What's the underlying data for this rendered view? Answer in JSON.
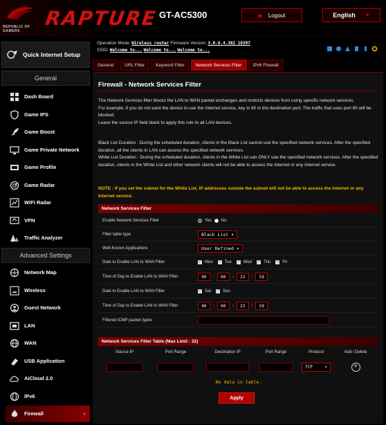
{
  "header": {
    "brand": "RAPTURE",
    "model": "GT-AC5300",
    "rog_line1": "REPUBLIC OF",
    "rog_line2": "GAMERS",
    "logout_label": "Logout",
    "language": "English"
  },
  "sidebar": {
    "quick_setup": "Quick Internet Setup",
    "general_title": "General",
    "general_items": [
      {
        "label": "Dash Board",
        "icon": "dashboard-icon"
      },
      {
        "label": "Game IPS",
        "icon": "shield-icon"
      },
      {
        "label": "Game Boost",
        "icon": "rocket-icon"
      },
      {
        "label": "Game Private Network",
        "icon": "private-network-icon"
      },
      {
        "label": "Game Profile",
        "icon": "profile-icon"
      },
      {
        "label": "Game Radar",
        "icon": "radar-icon"
      },
      {
        "label": "WiFi Radar",
        "icon": "wifi-radar-icon"
      },
      {
        "label": "VPN",
        "icon": "vpn-icon"
      },
      {
        "label": "Traffic Analyzer",
        "icon": "traffic-icon"
      }
    ],
    "advanced_title": "Advanced Settings",
    "advanced_items": [
      {
        "label": "Network Map",
        "icon": "network-map-icon"
      },
      {
        "label": "Wireless",
        "icon": "wireless-icon"
      },
      {
        "label": "Guest Network",
        "icon": "guest-icon"
      },
      {
        "label": "LAN",
        "icon": "lan-icon"
      },
      {
        "label": "WAN",
        "icon": "globe-icon"
      },
      {
        "label": "USB Application",
        "icon": "usb-icon"
      },
      {
        "label": "AiCloud 2.0",
        "icon": "cloud-icon"
      },
      {
        "label": "IPv6",
        "icon": "ipv6-icon"
      },
      {
        "label": "Firewall",
        "icon": "firewall-icon"
      }
    ]
  },
  "status": {
    "op_mode_label": "Operation Mode:",
    "op_mode_value": "Wireless router",
    "firmware_label": "Firmware Version:",
    "firmware_value": "3.0.0.4.382_10397",
    "ssid_label": "SSID:",
    "ssid_1": "Welcome to...",
    "ssid_2": "Welcome to...",
    "ssid_3": "Welcome to..."
  },
  "tabs": [
    "General",
    "URL Filter",
    "Keyword Filter",
    "Network Services Filter",
    "IPv6 Firewall"
  ],
  "active_tab_index": 3,
  "page": {
    "title": "Firewall - Network Services Filter",
    "desc1": "The Network Services filter blocks the LAN to WAN packet exchanges and restricts devices from using specific network services.",
    "desc2": "For example, if you do not want the device to use the Internet service, key in 80 in the destination port. The traffic that uses port 80 will be blocked.",
    "desc3": "Leave the source IP field blank to apply this rule to all LAN devices.",
    "desc4": "Black List Duration : During the scheduled duration, clients in the Black List cannot use the specified network services. After the specified duration, all the clients in LAN can access the specified network services.",
    "desc5": "White List Duration : During the scheduled duration, clients in the White List can ONLY use the specified network services. After the specified duration, clients in the White List and other network clients will not be able to access the Internet or any Internet service.",
    "note": "NOTE : If you set the subnet for the White List, IP addresses outside the subnet will not be able to access the Internet or any Internet service."
  },
  "form": {
    "section_title": "Network Services Filter",
    "enable_label": "Enable Network Services Filter",
    "yes": "Yes",
    "no": "No",
    "filter_type_label": "Filter table type",
    "filter_type_value": "Black List",
    "wk_apps_label": "Well-Known Applications",
    "wk_apps_value": "User Defined",
    "date1_label": "Date to Enable LAN to WAN Filter",
    "days1": [
      "Mon",
      "Tue",
      "Wed",
      "Thu",
      "Fri"
    ],
    "time1_label": "Time of Day to Enable LAN to WAN Filter",
    "time1": [
      "00",
      "00",
      "23",
      "59"
    ],
    "date2_label": "Date to Enable LAN to WAN Filter",
    "days2": [
      "Sat",
      "Sun"
    ],
    "time2_label": "Time of Day to Enable LAN to WAN Filter",
    "time2": [
      "00",
      "00",
      "23",
      "59"
    ],
    "icmp_label": "Filtered ICMP packet types"
  },
  "table": {
    "title": "Network Services Filter Table (Max Limit : 32)",
    "columns": [
      "Source IP",
      "Port Range",
      "Destination IP",
      "Port Range",
      "Protocol",
      "Add / Delete"
    ],
    "protocol_value": "TCP",
    "no_data": "No data in table."
  },
  "apply_label": "Apply",
  "colors": {
    "accent": "#b10000",
    "note": "#ffb400"
  }
}
